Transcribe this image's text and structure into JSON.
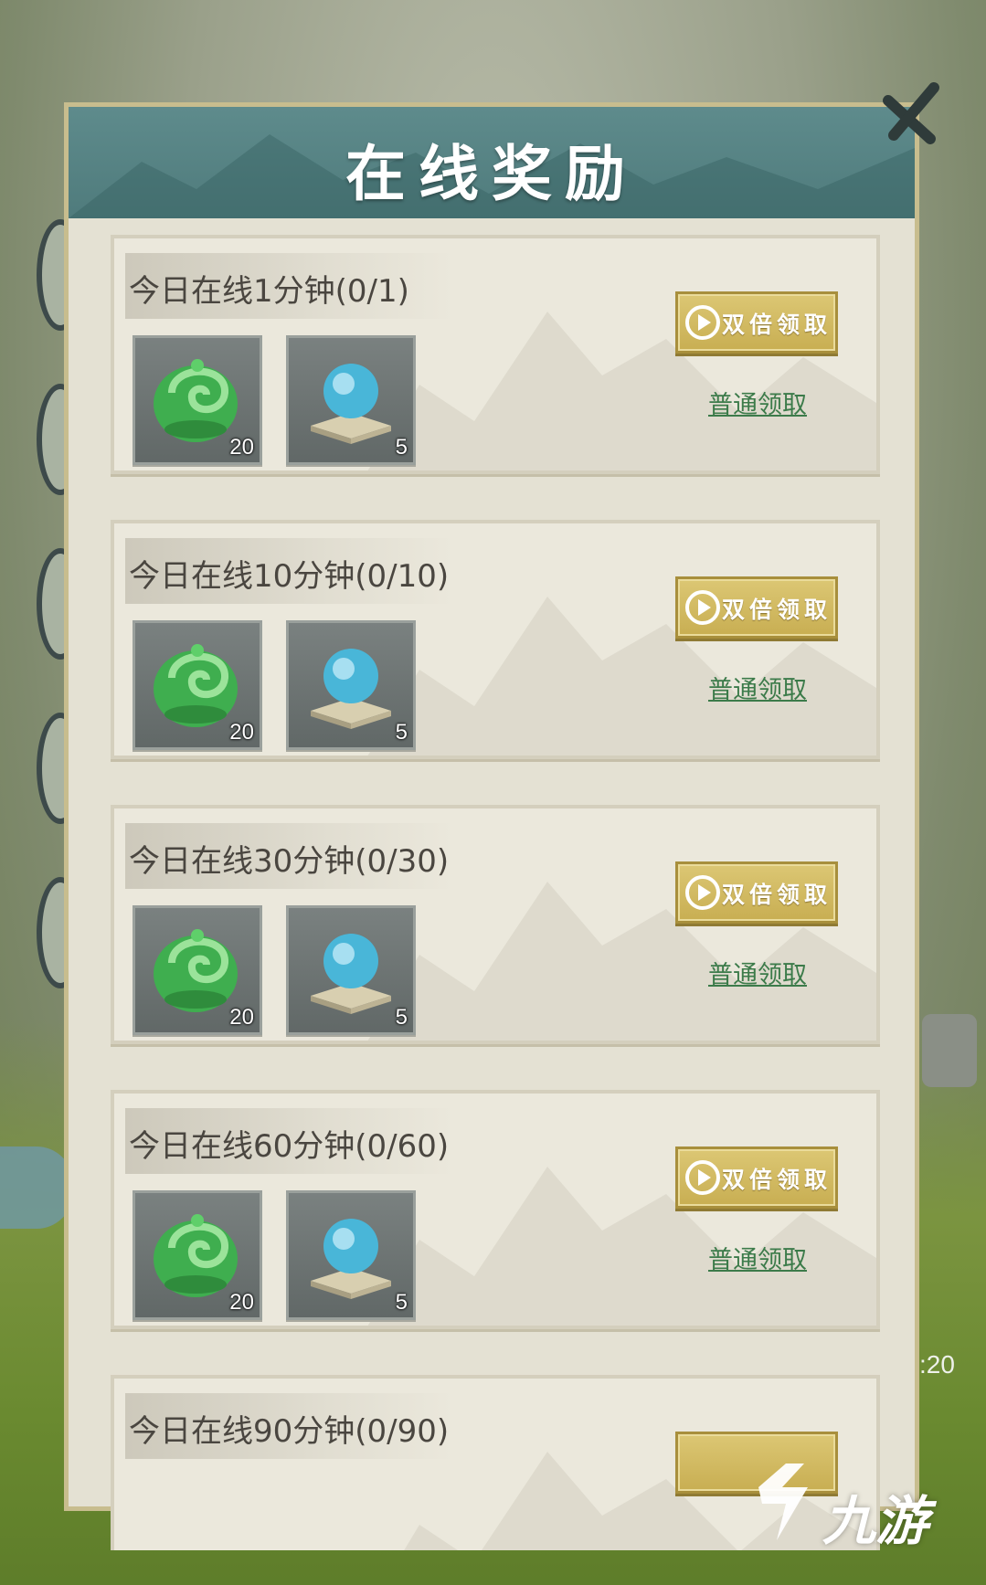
{
  "panel": {
    "title": "在线奖励"
  },
  "rewards": [
    {
      "title": "今日在线1分钟(0/1)",
      "items": [
        {
          "icon": "jade-pendant-icon",
          "count": "20"
        },
        {
          "icon": "blue-orb-icon",
          "count": "5"
        }
      ],
      "double_label": "双倍领取",
      "normal_label": "普通领取"
    },
    {
      "title": "今日在线10分钟(0/10)",
      "items": [
        {
          "icon": "jade-pendant-icon",
          "count": "20"
        },
        {
          "icon": "blue-orb-icon",
          "count": "5"
        }
      ],
      "double_label": "双倍领取",
      "normal_label": "普通领取"
    },
    {
      "title": "今日在线30分钟(0/30)",
      "items": [
        {
          "icon": "jade-pendant-icon",
          "count": "20"
        },
        {
          "icon": "blue-orb-icon",
          "count": "5"
        }
      ],
      "double_label": "双倍领取",
      "normal_label": "普通领取"
    },
    {
      "title": "今日在线60分钟(0/60)",
      "items": [
        {
          "icon": "jade-pendant-icon",
          "count": "20"
        },
        {
          "icon": "blue-orb-icon",
          "count": "5"
        }
      ],
      "double_label": "双倍领取",
      "normal_label": "普通领取"
    },
    {
      "title": "今日在线90分钟(0/90)",
      "items": [],
      "double_label": "",
      "normal_label": ""
    }
  ],
  "background": {
    "timer_fragment": ":20"
  },
  "watermark": {
    "text": "九游"
  },
  "colors": {
    "header_teal": "#54807f",
    "button_gold": "#d3bc63",
    "link_green": "#3c7b4a",
    "panel_bg": "#e4e1d3"
  }
}
